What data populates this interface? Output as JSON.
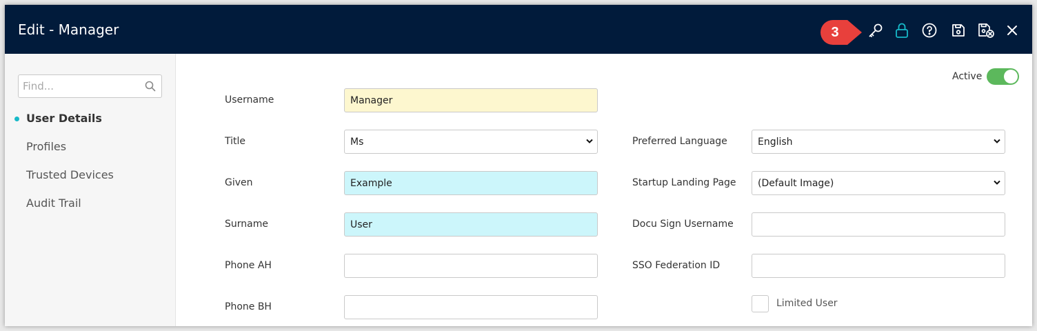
{
  "window": {
    "title": "Edit - Manager",
    "callout_number": "3",
    "toolbar_icons": [
      "key-icon",
      "lock-icon",
      "help-icon",
      "save-icon",
      "save-close-icon",
      "close-icon"
    ],
    "accent_colors": {
      "header": "#011b3b",
      "lock": "#17b9c8",
      "callout": "#e8403c",
      "toggle": "#5cb85c"
    }
  },
  "sidebar": {
    "find_placeholder": "Find...",
    "items": [
      {
        "label": "User Details",
        "active": true
      },
      {
        "label": "Profiles",
        "active": false
      },
      {
        "label": "Trusted Devices",
        "active": false
      },
      {
        "label": "Audit Trail",
        "active": false
      }
    ]
  },
  "form": {
    "active_label": "Active",
    "active": true,
    "username": {
      "label": "Username",
      "value": "Manager"
    },
    "title": {
      "label": "Title",
      "value": "Ms"
    },
    "given": {
      "label": "Given",
      "value": "Example"
    },
    "surname": {
      "label": "Surname",
      "value": "User"
    },
    "phone_ah": {
      "label": "Phone AH",
      "value": ""
    },
    "phone_bh": {
      "label": "Phone BH",
      "value": ""
    },
    "preferred_language": {
      "label": "Preferred Language",
      "value": "English"
    },
    "startup_landing_page": {
      "label": "Startup Landing Page",
      "value": "(Default Image)"
    },
    "docu_sign_username": {
      "label": "Docu Sign Username",
      "value": ""
    },
    "sso_federation_id": {
      "label": "SSO Federation ID",
      "value": ""
    },
    "limited_user": {
      "label": "Limited User",
      "checked": false
    }
  }
}
